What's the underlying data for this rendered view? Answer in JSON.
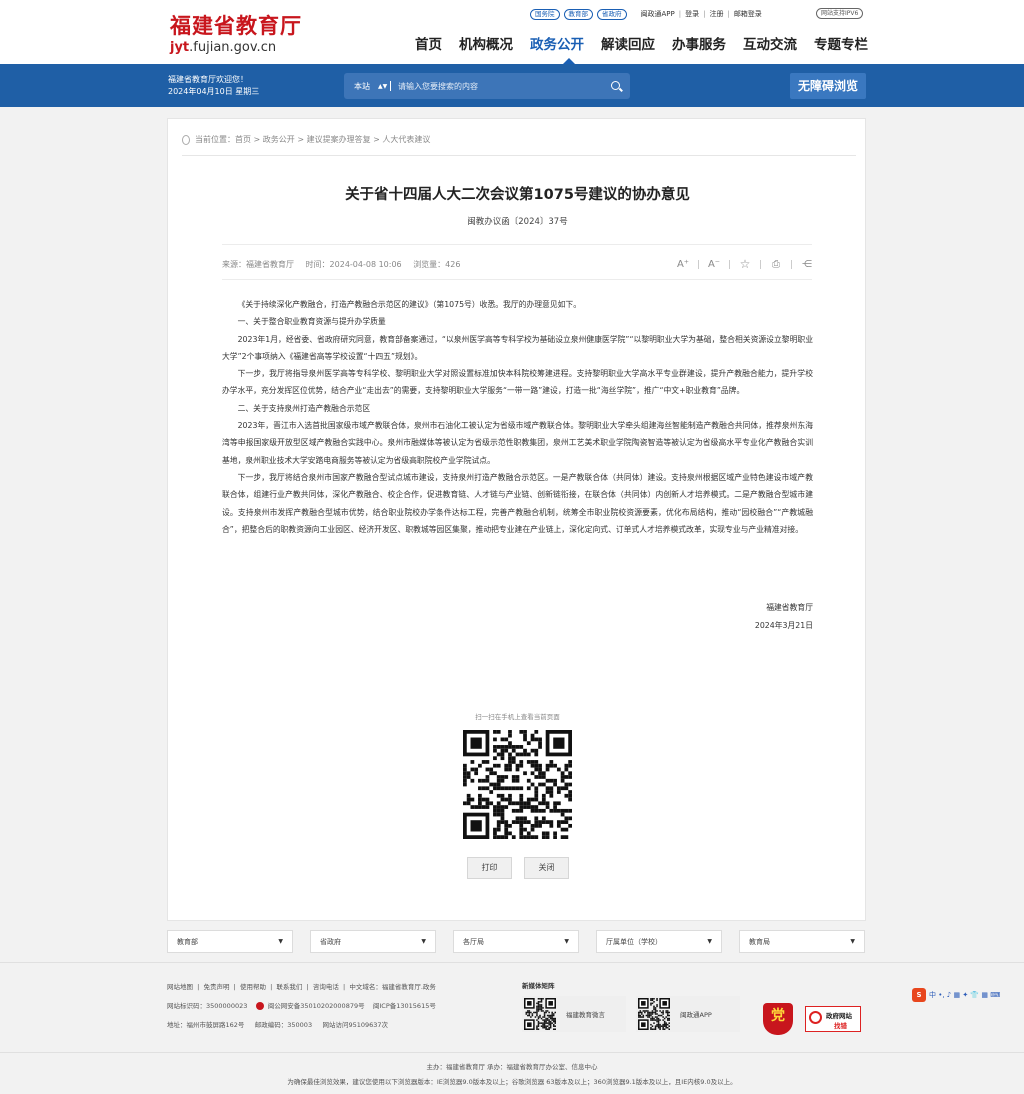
{
  "header": {
    "logo_cn": "福建省教育厅",
    "logo_en_prefix": "jyt",
    "logo_en_suffix": ".fujian.gov.cn",
    "pills": [
      "国务院",
      "教育部",
      "省政府"
    ],
    "app_link": "闽政通APP",
    "login": "登录",
    "register": "注册",
    "mail": "邮箱登录",
    "ipv6": "网站支持IPV6",
    "nav": [
      "首页",
      "机构概况",
      "政务公开",
      "解读回应",
      "办事服务",
      "互动交流",
      "专题专栏"
    ],
    "nav_active_index": 2
  },
  "bluebar": {
    "welcome": "福建省教育厅欢迎您！",
    "date": "2024年04月10日 星期三",
    "search_scope": "本站",
    "search_placeholder": "请输入您要搜索的内容",
    "a11y_button": "无障碍浏览"
  },
  "article": {
    "breadcrumb_label": "当前位置：",
    "breadcrumb": [
      "首页",
      "政务公开",
      "建议提案办理答复",
      "人大代表建议"
    ],
    "title": "关于省十四届人大二次会议第1075号建议的协办意见",
    "doc_number": "闽教办议函〔2024〕37号",
    "source": "来源：福建省教育厅",
    "time": "时间：2024-04-08 10:06",
    "views": "浏览量：426",
    "tools": {
      "font_larger": "A⁺",
      "font_smaller": "A⁻",
      "favorite": "☆",
      "print": "⎙",
      "share": "⋲"
    },
    "paragraphs": [
      "《关于持续深化产教融合，打造产教融合示范区的建议》（第1075号）收悉。我厅的办理意见如下。",
      "一、关于整合职业教育资源与提升办学质量",
      "2023年1月，经省委、省政府研究同意，教育部备案通过，“以泉州医学高等专科学校为基础设立泉州健康医学院”“以黎明职业大学为基础，整合相关资源设立黎明职业大学”2个事项纳入《福建省高等学校设置“十四五”规划》。",
      "下一步，我厅将指导泉州医学高等专科学校、黎明职业大学对照设置标准加快本科院校筹建进程。支持黎明职业大学高水平专业群建设，提升产教融合能力，提升学校办学水平，充分发挥区位优势，结合产业“走出去”的需要，支持黎明职业大学服务“一带一路”建设，打造一批“海丝学院”，推广“中文+职业教育”品牌。",
      "二、关于支持泉州打造产教融合示范区",
      "2023年，晋江市入选首批国家级市域产教联合体，泉州市石油化工被认定为省级市域产教联合体。黎明职业大学牵头组建海丝智能制造产教融合共同体，推荐泉州东海湾等申报国家级开放型区域产教融合实践中心。泉州市融媒体等被认定为省级示范性职教集团，泉州工艺美术职业学院陶瓷智造等被认定为省级高水平专业化产教融合实训基地，泉州职业技术大学安踏电商服务等被认定为省级高职院校产业学院试点。",
      "下一步，我厅将结合泉州市国家产教融合型试点城市建设，支持泉州打造产教融合示范区。一是产教联合体（共同体）建设。支持泉州根据区域产业特色建设市域产教联合体，组建行业产教共同体，深化产教融合、校企合作，促进教育链、人才链与产业链、创新链衔接，在联合体（共同体）内创新人才培养模式。二是产教融合型城市建设。支持泉州市发挥产教融合型城市优势，结合职业院校办学条件达标工程，完善产教融合机制，统筹全市职业院校资源要素，优化布局结构，推动“园校融合”“产教城融合”，把整合后的职教资源向工业园区、经济开发区、职教城等园区集聚，推动把专业建在产业链上，深化定向式、订单式人才培养模式改革，实现专业与产业精准对接。"
    ],
    "sign_org": "福建省教育厅",
    "sign_date": "2024年3月21日",
    "qr_caption": "扫一扫在手机上查看当前页面",
    "print_button": "打印",
    "close_button": "关闭"
  },
  "footer": {
    "selects": [
      "教育部",
      "省政府",
      "各厅局",
      "厅属单位（学校）",
      "教育局"
    ],
    "links": [
      "网站地图",
      "免责声明",
      "使用帮助",
      "联系我们",
      "咨询电话",
      "中文域名：福建省教育厅.政务"
    ],
    "site_code": "网站标识码：3500000023",
    "police": "闽公网安备35010202000879号",
    "icp": "闽ICP备13015615号",
    "address": "地址：福州市鼓屏路162号",
    "postcode": "邮政编码：350003",
    "visits": "网站访问95109637次",
    "media_title": "新媒体矩阵",
    "media": [
      "福建教育微言",
      "闽政通APP"
    ],
    "party_glyph": "党",
    "find_error_1": "政府网站",
    "find_error_2": "找错",
    "ime_brand": "S",
    "ime_icons": "中 •, ♪ ▦ ✦ 👕 ▦ ⌨",
    "host": "主办：福建省教育厅    承办：福建省教育厅办公室、信息中心",
    "browser_note": "为确保最佳浏览效果，建议您使用以下浏览器版本：IE浏览器9.0版本及以上；谷歌浏览器 63版本及以上；360浏览器9.1版本及以上，且IE内核9.0及以上。"
  },
  "colors": {
    "brand_red": "#c8161d",
    "brand_blue": "#1f5fa6",
    "nav_active": "#1a5fb4"
  }
}
